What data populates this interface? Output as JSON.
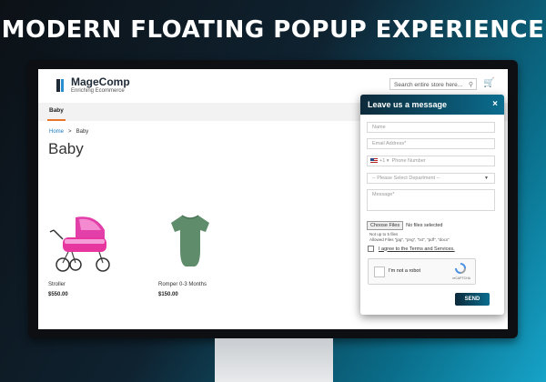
{
  "headline": "MODERN FLOATING POPUP EXPERIENCE",
  "store": {
    "logo_name": "MageComp",
    "logo_tagline": "Enriching Ecommerce",
    "search_placeholder": "Search entire store here...",
    "nav": [
      "Baby"
    ],
    "breadcrumb": {
      "home": "Home",
      "sep": ">",
      "current": "Baby"
    },
    "page_title": "Baby",
    "products": [
      {
        "name": "Stroller",
        "price": "$550.00"
      },
      {
        "name": "Romper 0-3 Months",
        "price": "$150.00"
      }
    ]
  },
  "popup": {
    "title": "Leave us a message",
    "close_icon": "×",
    "fields": {
      "name": "Name",
      "email": "Email Address*",
      "phone_code": "+1 ▾",
      "phone": "Phone Number",
      "department": "-- Please Select Department --",
      "message": "Message*"
    },
    "choose_files": "Choose Files",
    "no_file": "No files selected",
    "file_notes": [
      "Not up to 5 files",
      "Allowed Files \"jpg\", \"png\", \"txt\", \"pdf\", \"docx\""
    ],
    "terms": "I agree to the Terms and Services.",
    "captcha_label": "I'm not a robot",
    "captcha_brand": "reCAPTCHA",
    "send": "SEND"
  },
  "colors": {
    "accent": "#0a6d8f",
    "nav_underline": "#e8762a",
    "link": "#1979c3"
  }
}
